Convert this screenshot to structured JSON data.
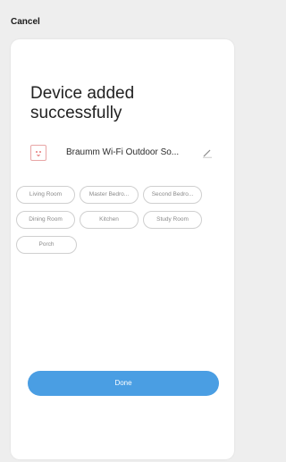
{
  "header": {
    "cancel_label": "Cancel"
  },
  "main": {
    "title": "Device added successfully",
    "device": {
      "icon": "smart-plug-icon",
      "name": "Braumm Wi-Fi Outdoor So...",
      "edit_icon": "pencil-icon"
    },
    "rooms": [
      {
        "label": "Living Room"
      },
      {
        "label": "Master Bedro..."
      },
      {
        "label": "Second Bedro..."
      },
      {
        "label": "Dining Room"
      },
      {
        "label": "Kitchen"
      },
      {
        "label": "Study Room"
      },
      {
        "label": "Porch"
      }
    ],
    "done_label": "Done"
  },
  "colors": {
    "accent": "#4a9ee3",
    "background": "#eeeeee",
    "card": "#ffffff",
    "chip_border": "#cfcfcf",
    "chip_text": "#8a8a8a"
  }
}
